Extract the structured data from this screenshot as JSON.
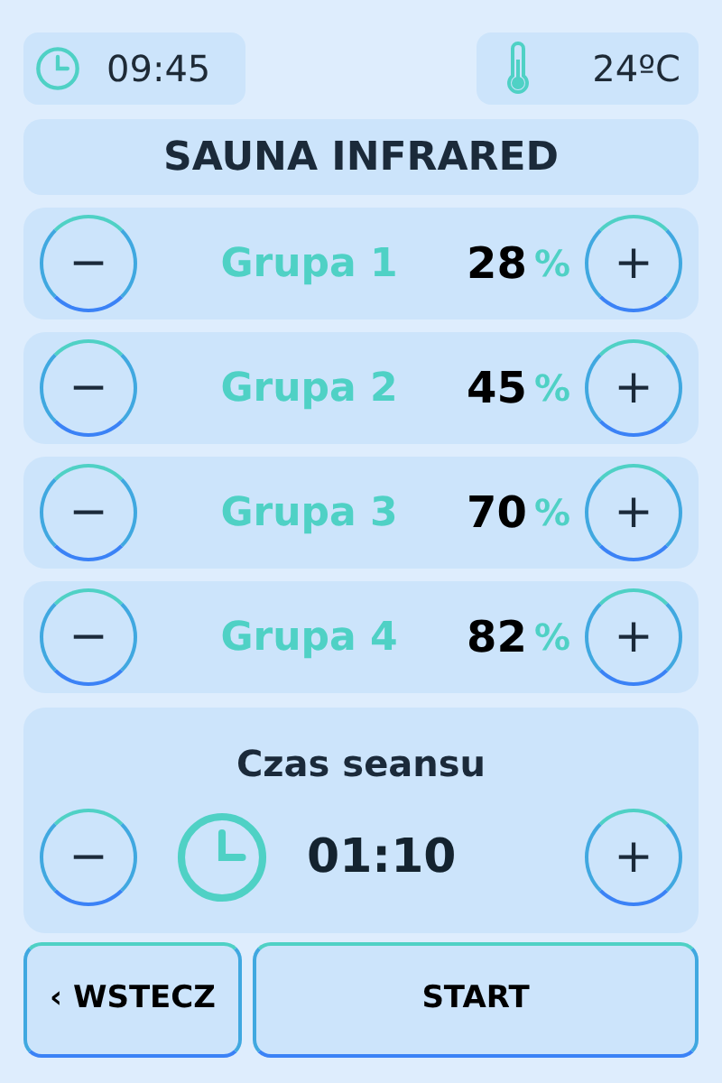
{
  "status": {
    "time": "09:45",
    "temperature": "24ºC"
  },
  "title": "SAUNA INFRARED",
  "groups": [
    {
      "minus": "−",
      "name": "Grupa 1",
      "value": "28",
      "unit": "%",
      "plus": "+"
    },
    {
      "minus": "−",
      "name": "Grupa 2",
      "value": "45",
      "unit": "%",
      "plus": "+"
    },
    {
      "minus": "−",
      "name": "Grupa 3",
      "value": "70",
      "unit": "%",
      "plus": "+"
    },
    {
      "minus": "−",
      "name": "Grupa 4",
      "value": "82",
      "unit": "%",
      "plus": "+"
    }
  ],
  "session": {
    "label": "Czas seansu",
    "minus": "−",
    "time": "01:10",
    "plus": "+"
  },
  "buttons": [
    "‹ WSTECZ",
    "START"
  ]
}
